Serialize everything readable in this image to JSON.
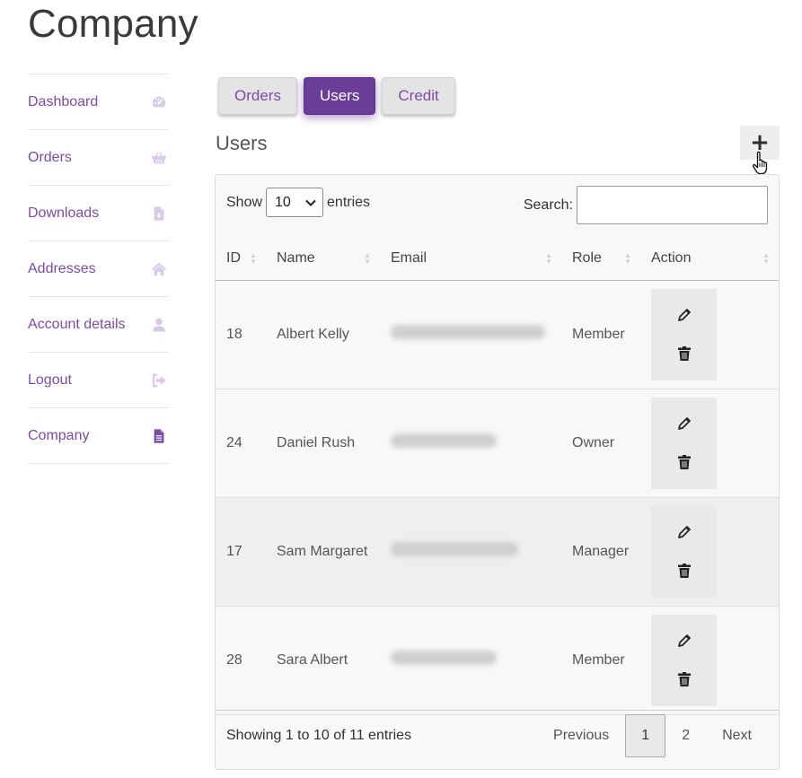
{
  "page": {
    "title": "Company"
  },
  "sidebar": {
    "items": [
      {
        "label": "Dashboard",
        "icon": "gauge-icon",
        "active": false
      },
      {
        "label": "Orders",
        "icon": "basket-icon",
        "active": false
      },
      {
        "label": "Downloads",
        "icon": "file-download-icon",
        "active": false
      },
      {
        "label": "Addresses",
        "icon": "home-icon",
        "active": false
      },
      {
        "label": "Account details",
        "icon": "user-icon",
        "active": false
      },
      {
        "label": "Logout",
        "icon": "sign-out-icon",
        "active": false
      },
      {
        "label": "Company",
        "icon": "document-icon",
        "active": true
      }
    ]
  },
  "tabs": [
    {
      "label": "Orders",
      "active": false
    },
    {
      "label": "Users",
      "active": true
    },
    {
      "label": "Credit",
      "active": false
    }
  ],
  "section": {
    "title": "Users",
    "add_label": "+"
  },
  "table_controls": {
    "show_label": "Show",
    "entries_value": "10",
    "entries_label": "entries",
    "search_label": "Search:",
    "search_value": ""
  },
  "table": {
    "columns": [
      "ID",
      "Name",
      "Email",
      "Role",
      "Action"
    ],
    "rows": [
      {
        "id": "18",
        "name": "Albert Kelly",
        "role": "Member"
      },
      {
        "id": "24",
        "name": "Daniel Rush",
        "role": "Owner"
      },
      {
        "id": "17",
        "name": "Sam Margaret",
        "role": "Manager"
      },
      {
        "id": "28",
        "name": "Sara Albert",
        "role": "Member"
      }
    ]
  },
  "footer": {
    "info": "Showing 1 to 10 of 11 entries",
    "previous": "Previous",
    "pages": [
      "1",
      "2"
    ],
    "current_page": "1",
    "next": "Next"
  },
  "colors": {
    "accent": "#6a3d99",
    "link": "#7b4ba6",
    "icon_muted": "#d7c9e6"
  }
}
